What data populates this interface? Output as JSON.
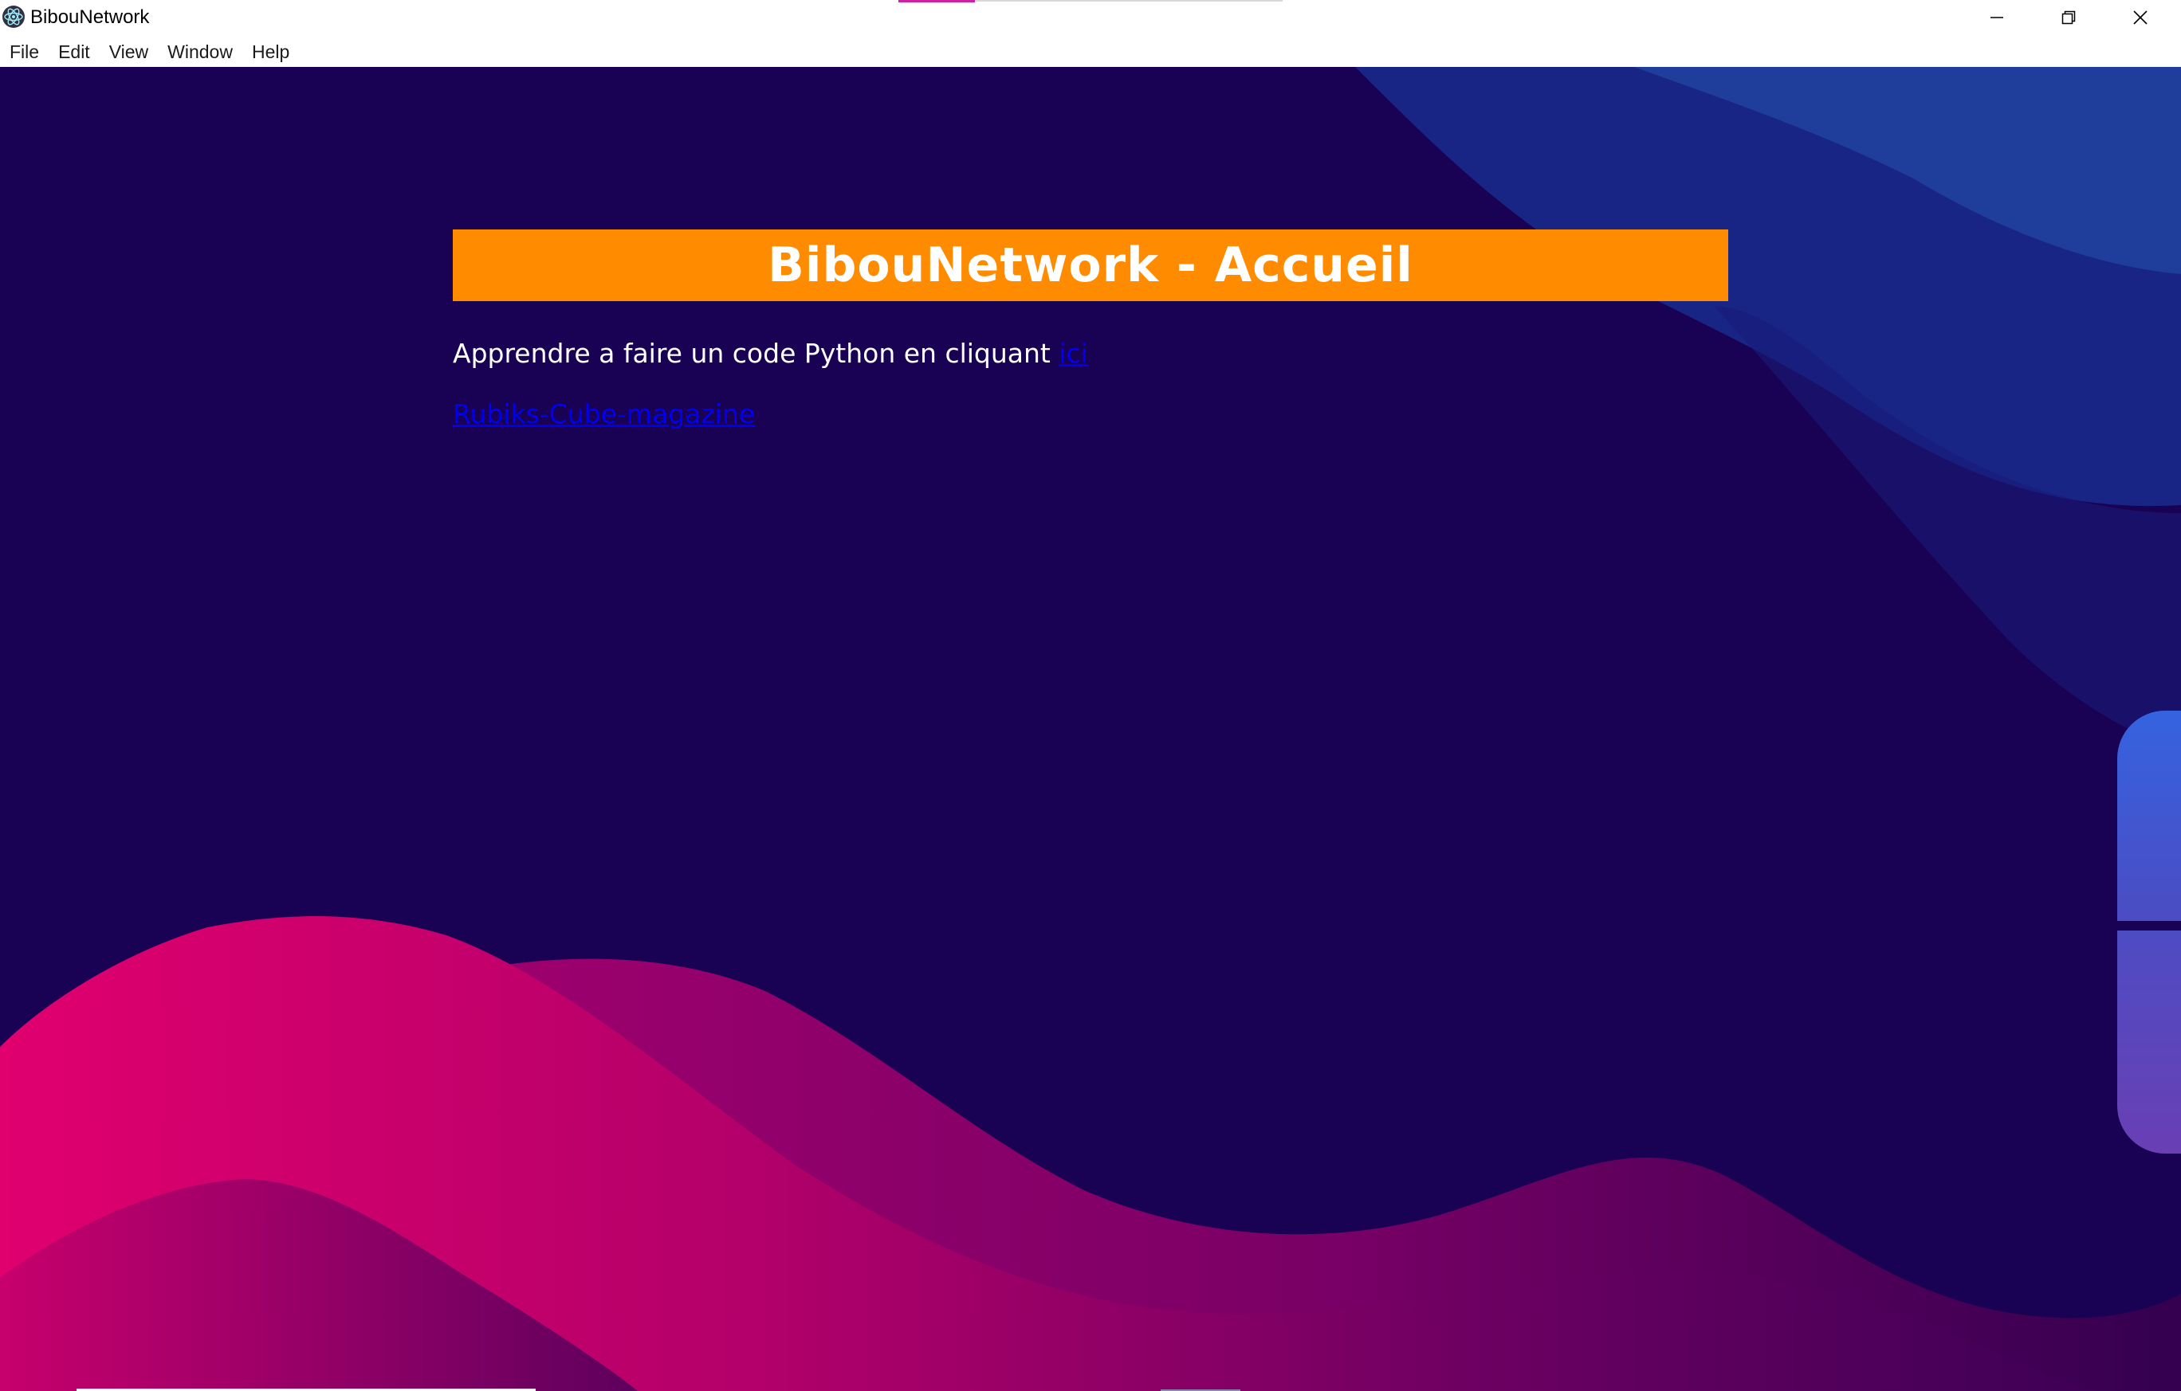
{
  "window": {
    "title": "BibouNetwork",
    "app_icon": "electron-atom-icon",
    "controls": {
      "minimize_icon": "minimize-icon",
      "maximize_icon": "restore-icon",
      "close_icon": "close-icon"
    }
  },
  "menu": {
    "items": [
      "File",
      "Edit",
      "View",
      "Window",
      "Help"
    ]
  },
  "page": {
    "banner_title": "BibouNetwork - Accueil",
    "intro_text": "Apprendre a faire un code Python en cliquant ",
    "intro_link": "ici",
    "second_link": "Rubiks-Cube-magazine"
  },
  "colors": {
    "background": "#190154",
    "banner": "#ff8c00",
    "link": "#0000ee",
    "wave_pink": "#c8006e",
    "wave_blue": "#1b3b9c"
  }
}
